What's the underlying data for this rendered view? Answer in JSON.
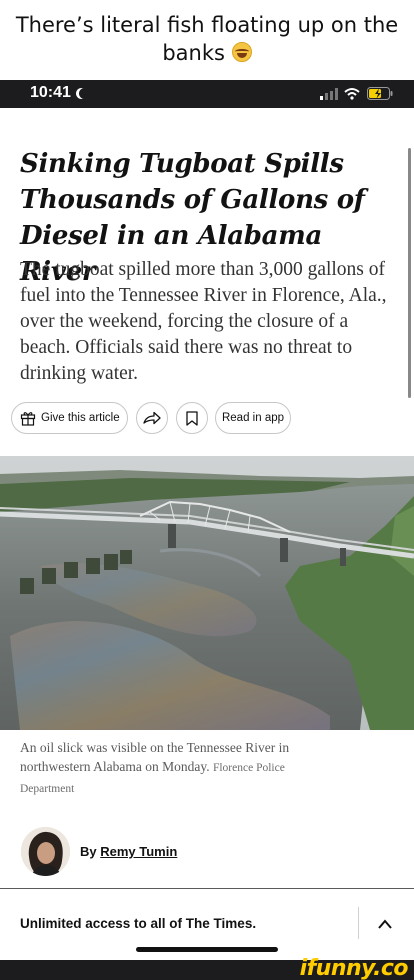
{
  "meme": {
    "caption": "There’s literal fish floating up on the banks"
  },
  "status": {
    "time": "10:41"
  },
  "article": {
    "headline": "Sinking Tugboat Spills Thousands of Gallons of Diesel in an Alabama River",
    "summary": "The tugboat spilled more than 3,000 gallons of fuel into the Tennessee River in Florence, Ala., over the weekend, forcing the closure of a beach. Officials said there was no threat to drinking water.",
    "actions": {
      "give": "Give this article",
      "read": "Read in app"
    },
    "caption": "An oil slick was visible on the Tennessee River in northwestern Alabama on Monday.",
    "credit": "Florence Police Department",
    "byline_prefix": "By",
    "author": "Remy Tumin"
  },
  "bottom_bar": {
    "text": "Unlimited access to all of The Times."
  },
  "watermark": {
    "text": "ifunny.co"
  }
}
